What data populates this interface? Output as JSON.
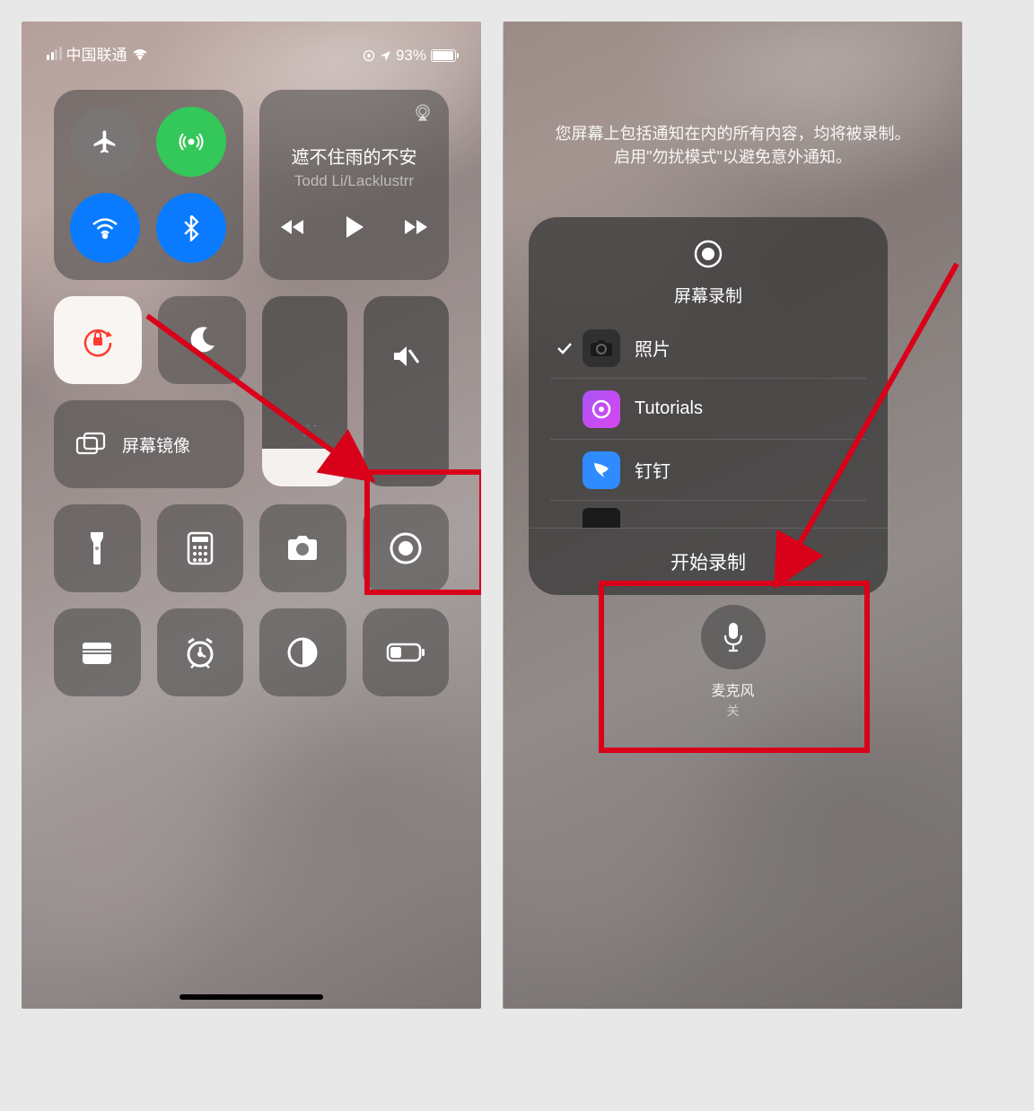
{
  "statusBar": {
    "carrier": "中国联通",
    "batteryPct": "93%"
  },
  "music": {
    "title": "遮不住雨的不安",
    "artist": "Todd Li/Lacklustrr"
  },
  "screenMirror": "屏幕镜像",
  "right": {
    "info_line1": "您屏幕上包括通知在内的所有内容，均将被录制。",
    "info_line2": "启用\"勿扰模式\"以避免意外通知。",
    "panel_title": "屏幕录制",
    "start_label": "开始录制",
    "apps": [
      {
        "name": "照片",
        "checked": true
      },
      {
        "name": "Tutorials",
        "checked": false
      },
      {
        "name": "钉钉",
        "checked": false
      }
    ],
    "mic_label": "麦克风",
    "mic_state": "关"
  }
}
